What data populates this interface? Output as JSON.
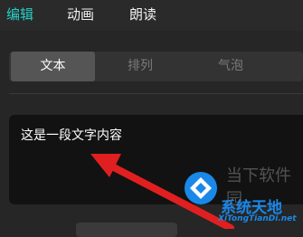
{
  "tabs": {
    "items": [
      {
        "label": "编辑",
        "active": true
      },
      {
        "label": "动画",
        "active": false
      },
      {
        "label": "朗读",
        "active": false
      }
    ]
  },
  "segments": {
    "items": [
      {
        "label": "文本",
        "active": true
      },
      {
        "label": "排列",
        "active": false
      },
      {
        "label": "气泡",
        "active": false
      }
    ]
  },
  "editor": {
    "content": "这是一段文字内容"
  },
  "watermark": {
    "top_text": "当下软件园",
    "brand": "系统天地",
    "url": "XiTongTianDi.net"
  },
  "colors": {
    "accent": "#25d0c8",
    "arrow": "#e02020",
    "watermark_blue": "#1a88e8"
  }
}
